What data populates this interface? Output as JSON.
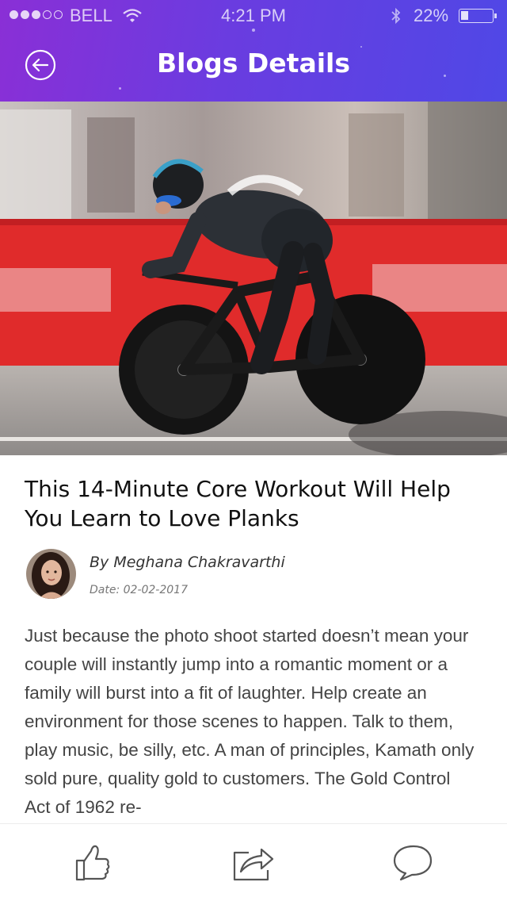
{
  "status_bar": {
    "carrier": "BELL",
    "time": "4:21 PM",
    "battery_percent": "22%",
    "battery_level": 0.22,
    "signal_bars_filled": 3,
    "signal_bars_total": 5
  },
  "nav": {
    "title": "Blogs Details",
    "back_icon": "back-arrow-circle-icon"
  },
  "article": {
    "title": "This 14-Minute Core Workout Will Help You Learn to Love Planks",
    "author": "By Meghana Chakravarthi",
    "date": "Date: 02-02-2017",
    "body": "Just because the photo shoot started doesn’t mean your couple will instantly jump into a romantic moment or a family will burst into a fit of laughter. Help create an environment for those scenes to happen.  Talk to them, play music, be silly, etc. A man of principles, Kamath only sold pure, quality gold to customers. The Gold Control Act of 1962 re-"
  },
  "toolbar": {
    "icons": [
      "thumbs-up-icon",
      "share-icon",
      "comment-icon"
    ]
  },
  "colors": {
    "header_start": "#8a2fd6",
    "header_end": "#4f48e6",
    "title_text": "#111111",
    "body_text": "#444444",
    "icon_stroke": "#555555"
  }
}
